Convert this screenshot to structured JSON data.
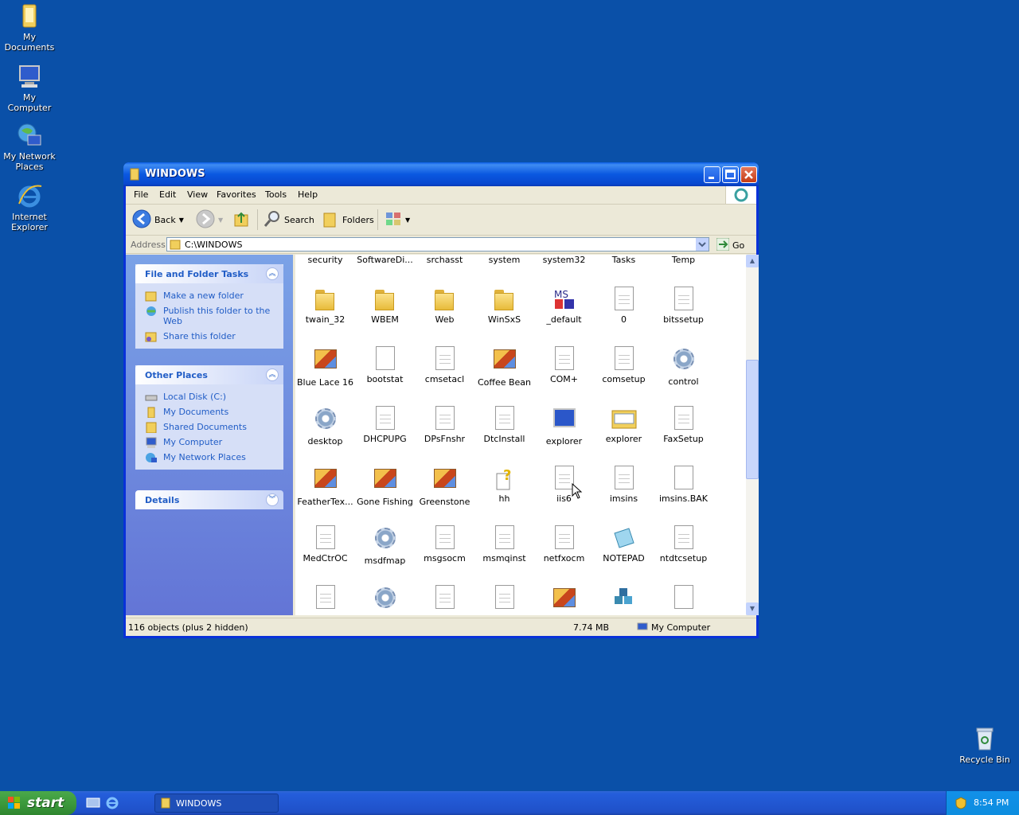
{
  "desktop": {
    "icons": [
      {
        "label": "My Documents"
      },
      {
        "label": "My Computer"
      },
      {
        "label": "My Network Places"
      },
      {
        "label": "Internet Explorer"
      },
      {
        "label": "Recycle Bin"
      }
    ]
  },
  "window": {
    "title": "WINDOWS",
    "menu": [
      "File",
      "Edit",
      "View",
      "Favorites",
      "Tools",
      "Help"
    ],
    "toolbar": {
      "back": "Back",
      "search": "Search",
      "folders": "Folders"
    },
    "address": {
      "label": "Address",
      "value": "C:\\WINDOWS",
      "go": "Go"
    },
    "tasks": {
      "file_folder": {
        "title": "File and Folder Tasks",
        "items": [
          "Make a new folder",
          "Publish this folder to the Web",
          "Share this folder"
        ]
      },
      "other_places": {
        "title": "Other Places",
        "items": [
          "Local Disk (C:)",
          "My Documents",
          "Shared Documents",
          "My Computer",
          "My Network Places"
        ]
      },
      "details": {
        "title": "Details"
      }
    },
    "files": [
      {
        "name": "security",
        "icon": "none"
      },
      {
        "name": "SoftwareDi...",
        "icon": "none"
      },
      {
        "name": "srchasst",
        "icon": "none"
      },
      {
        "name": "system",
        "icon": "none"
      },
      {
        "name": "system32",
        "icon": "none"
      },
      {
        "name": "Tasks",
        "icon": "none"
      },
      {
        "name": "Temp",
        "icon": "none"
      },
      {
        "name": "twain_32",
        "icon": "folder"
      },
      {
        "name": "WBEM",
        "icon": "folder"
      },
      {
        "name": "Web",
        "icon": "folder"
      },
      {
        "name": "WinSxS",
        "icon": "folder"
      },
      {
        "name": "_default",
        "icon": "ms-logo"
      },
      {
        "name": "0",
        "icon": "doc"
      },
      {
        "name": "bitssetup",
        "icon": "doc"
      },
      {
        "name": "Blue Lace 16",
        "icon": "paint"
      },
      {
        "name": "bootstat",
        "icon": "blank"
      },
      {
        "name": "cmsetacl",
        "icon": "doc"
      },
      {
        "name": "Coffee Bean",
        "icon": "paint"
      },
      {
        "name": "COM+",
        "icon": "doc"
      },
      {
        "name": "comsetup",
        "icon": "doc"
      },
      {
        "name": "control",
        "icon": "gear"
      },
      {
        "name": "desktop",
        "icon": "gear"
      },
      {
        "name": "DHCPUPG",
        "icon": "doc"
      },
      {
        "name": "DPsFnshr",
        "icon": "doc"
      },
      {
        "name": "DtcInstall",
        "icon": "doc"
      },
      {
        "name": "explorer",
        "icon": "computer"
      },
      {
        "name": "explorer",
        "icon": "folder-window"
      },
      {
        "name": "FaxSetup",
        "icon": "doc"
      },
      {
        "name": "FeatherTex...",
        "icon": "paint"
      },
      {
        "name": "Gone Fishing",
        "icon": "paint"
      },
      {
        "name": "Greenstone",
        "icon": "paint"
      },
      {
        "name": "hh",
        "icon": "help"
      },
      {
        "name": "iis6",
        "icon": "doc"
      },
      {
        "name": "imsins",
        "icon": "doc"
      },
      {
        "name": "imsins.BAK",
        "icon": "blank"
      },
      {
        "name": "MedCtrOC",
        "icon": "doc"
      },
      {
        "name": "msdfmap",
        "icon": "gear"
      },
      {
        "name": "msgsocm",
        "icon": "doc"
      },
      {
        "name": "msmqinst",
        "icon": "doc"
      },
      {
        "name": "netfxocm",
        "icon": "doc"
      },
      {
        "name": "NOTEPAD",
        "icon": "notepad"
      },
      {
        "name": "ntdtcsetup",
        "icon": "doc"
      },
      {
        "name": "",
        "icon": "doc"
      },
      {
        "name": "",
        "icon": "gear"
      },
      {
        "name": "",
        "icon": "doc"
      },
      {
        "name": "",
        "icon": "doc"
      },
      {
        "name": "",
        "icon": "paint"
      },
      {
        "name": "",
        "icon": "cubes"
      },
      {
        "name": "",
        "icon": "blank"
      }
    ],
    "status": {
      "objects": "116 objects (plus 2 hidden)",
      "size": "7.74 MB",
      "location": "My Computer"
    }
  },
  "taskbar": {
    "start": "start",
    "window_button": "WINDOWS",
    "clock": "8:54 PM"
  }
}
